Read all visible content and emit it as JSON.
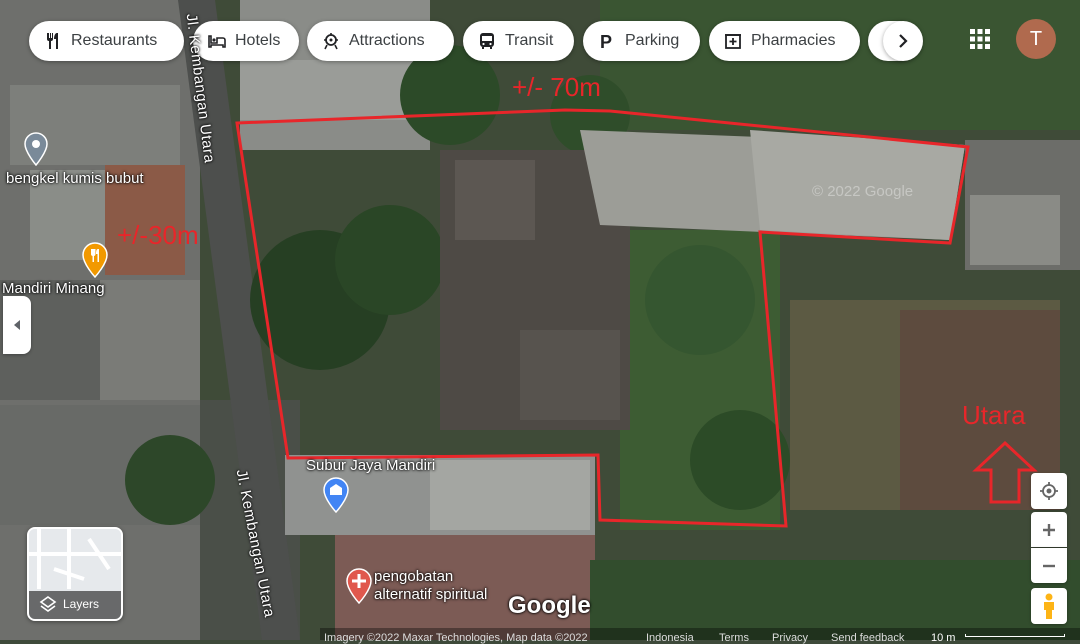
{
  "categories": [
    {
      "label": "Restaurants",
      "icon": "restaurant-icon"
    },
    {
      "label": "Hotels",
      "icon": "bed-icon"
    },
    {
      "label": "Attractions",
      "icon": "attraction-icon"
    },
    {
      "label": "Transit",
      "icon": "bus-icon"
    },
    {
      "label": "Parking",
      "icon": "parking-icon"
    },
    {
      "label": "Pharmacies",
      "icon": "pharmacy-icon"
    }
  ],
  "account": {
    "initial": "T",
    "color": "#b06a4e"
  },
  "map": {
    "streets": [
      {
        "name": "Jl. Kembangan Utara"
      },
      {
        "name": "Jl. Kembangan Utara"
      }
    ],
    "places": [
      {
        "name": "bengkel kumis bubut",
        "icon": "place-pin-icon",
        "color": "#7a8a99"
      },
      {
        "name": "Mandiri Minang",
        "icon": "food-pin-icon",
        "color": "#f29900"
      },
      {
        "name": "Subur Jaya Mandiri",
        "icon": "shop-pin-icon",
        "color": "#4285f4"
      },
      {
        "name": "pengobatan\nalternatif spiritual",
        "icon": "health-pin-icon",
        "color": "#e0584d"
      }
    ],
    "annotations": {
      "width": "+/- 70m",
      "depth": "+/-30m",
      "north": "Utara"
    },
    "boundary_color": "#e8262a",
    "logo": "Google",
    "watermark": "© 2022 Google"
  },
  "layers": {
    "label": "Layers"
  },
  "footer": {
    "attribution": "Imagery ©2022 Maxar Technologies, Map data ©2022",
    "country": "Indonesia",
    "terms": "Terms",
    "privacy": "Privacy",
    "feedback": "Send feedback",
    "scale": "10 m"
  }
}
